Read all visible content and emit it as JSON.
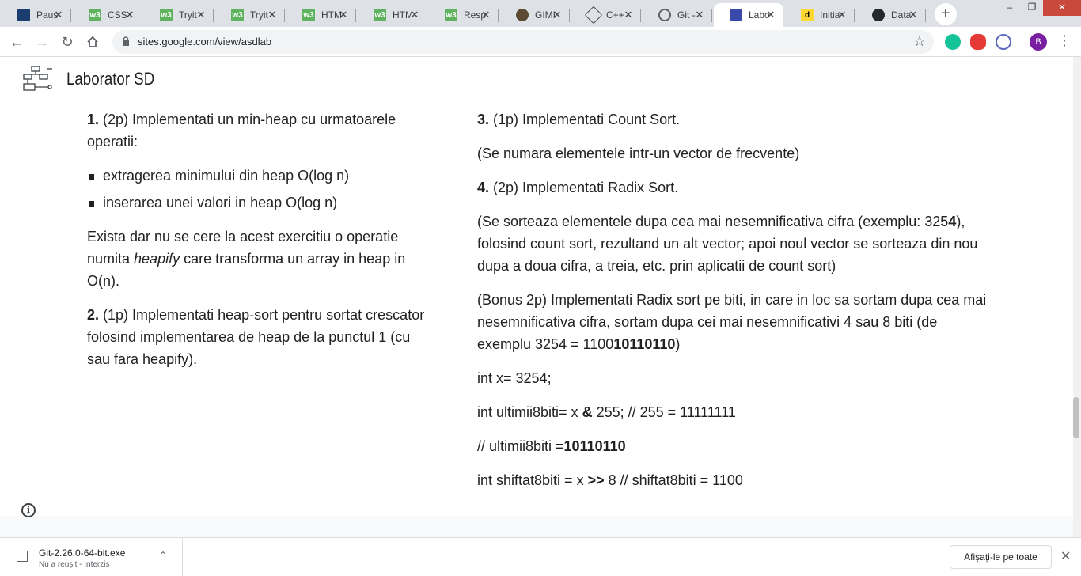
{
  "tabs": [
    {
      "title": "Paus",
      "favicon": "video-icon"
    },
    {
      "title": "CSS l",
      "favicon": "w3schools-icon"
    },
    {
      "title": "Tryit",
      "favicon": "w3schools-icon"
    },
    {
      "title": "Tryit",
      "favicon": "w3schools-icon"
    },
    {
      "title": "HTM",
      "favicon": "w3schools-icon"
    },
    {
      "title": "HTM",
      "favicon": "w3schools-icon"
    },
    {
      "title": "Resp",
      "favicon": "w3schools-icon"
    },
    {
      "title": "GIMI",
      "favicon": "gimp-icon"
    },
    {
      "title": "C++",
      "favicon": "cpp-icon"
    },
    {
      "title": "Git -",
      "favicon": "globe-icon"
    },
    {
      "title": "Labo",
      "favicon": "sites-icon",
      "active": true
    },
    {
      "title": "Initia",
      "favicon": "d-icon"
    },
    {
      "title": "Data",
      "favicon": "github-icon"
    }
  ],
  "window_controls": {
    "minimize": "–",
    "maximize": "❐",
    "close": "✕"
  },
  "address_bar": {
    "url": "sites.google.com/view/asdlab"
  },
  "profile": {
    "initial": "B"
  },
  "site": {
    "title": "Laborator SD"
  },
  "left_column": {
    "ex1": {
      "num": "1.",
      "text": " (2p) Implementati un min-heap cu urmatoarele operatii:"
    },
    "bullets": [
      "extragerea minimului din heap O(log n)",
      "inserarea unei valori in heap O(log n)"
    ],
    "heapify_note": {
      "before": "Exista dar nu se cere la acest exercitiu o operatie numita ",
      "italic": "heapify",
      "after": " care transforma un array in heap in O(n)."
    },
    "ex2": {
      "num": "2.",
      "text": " (1p) Implementati heap-sort pentru sortat crescator folosind implementarea de heap de la punctul 1 (cu sau fara heapify)."
    }
  },
  "right_column": {
    "ex3": {
      "num": "3.",
      "text": " (1p) Implementati Count Sort."
    },
    "ex3_note": "(Se numara elementele intr-un vector de frecvente)",
    "ex4": {
      "num": "4.",
      "text": " (2p) Implementati Radix Sort."
    },
    "ex4_note": {
      "before": "(Se sorteaza elementele dupa cea mai nesemnificativa cifra (exemplu: 325",
      "bold": "4",
      "after": "), folosind count sort, rezultand un alt vector; apoi noul vector se sorteaza din nou dupa a doua cifra, a treia, etc. prin aplicatii de count sort)"
    },
    "bonus": {
      "before": "(Bonus 2p) Implementati Radix sort pe biti, in care in loc sa sortam dupa cea mai nesemnificativa cifra, sortam dupa cei mai nesemnificativi 4 sau 8 biti (de exemplu 3254 = 1100",
      "bold": "10110110",
      "after": ")"
    },
    "code1": "int x= 3254;",
    "code2": {
      "before": "int ultimii8biti= x ",
      "bold": "&",
      "after": " 255; // 255 = 11111111"
    },
    "code3": {
      "before": "// ultimii8biti =",
      "bold": "10110110"
    },
    "code4": {
      "before": "int shiftat8biti = x ",
      "bold": ">>",
      "after": " 8 // shiftat8biti = 1100"
    }
  },
  "download": {
    "filename": "Git-2.26.0-64-bit.exe",
    "status": "Nu a reușit - Interzis",
    "show_all": "Afișați-le pe toate"
  }
}
